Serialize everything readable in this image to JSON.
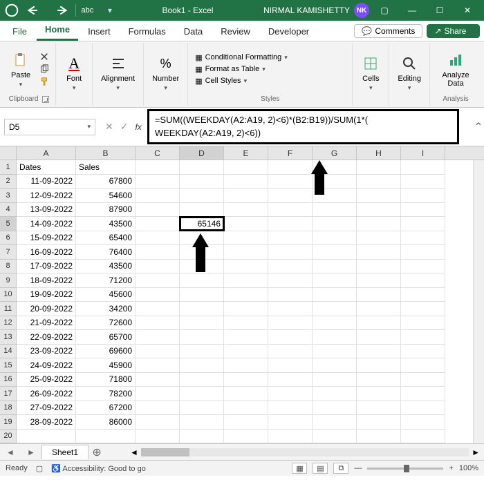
{
  "titlebar": {
    "doc": "Book1 - Excel",
    "user_name": "NIRMAL KAMISHETTY",
    "user_initials": "NK"
  },
  "tabs": {
    "file": "File",
    "home": "Home",
    "insert": "Insert",
    "formulas": "Formulas",
    "data": "Data",
    "review": "Review",
    "developer": "Developer",
    "comments": "Comments",
    "share": "Share"
  },
  "ribbon": {
    "clipboard": "Clipboard",
    "paste": "Paste",
    "font": "Font",
    "alignment": "Alignment",
    "number": "Number",
    "styles": "Styles",
    "cf": "Conditional Formatting",
    "fat": "Format as Table",
    "cs": "Cell Styles",
    "cells": "Cells",
    "editing": "Editing",
    "analyze": "Analyze Data",
    "analysis": "Analysis"
  },
  "editor": {
    "namebox": "D5",
    "formula_l1": "=SUM((WEEKDAY(A2:A19, 2)<6)*(B2:B19))/SUM(1*(",
    "formula_l2": "WEEKDAY(A2:A19, 2)<6))"
  },
  "columns": [
    "A",
    "B",
    "C",
    "D",
    "E",
    "F",
    "G",
    "H",
    "I"
  ],
  "headers": {
    "A": "Dates",
    "B": "Sales"
  },
  "rows": [
    {
      "n": 1,
      "A": "Dates",
      "B": "Sales"
    },
    {
      "n": 2,
      "A": "11-09-2022",
      "B": "67800"
    },
    {
      "n": 3,
      "A": "12-09-2022",
      "B": "54600"
    },
    {
      "n": 4,
      "A": "13-09-2022",
      "B": "87900"
    },
    {
      "n": 5,
      "A": "14-09-2022",
      "B": "43500",
      "D": "65146"
    },
    {
      "n": 6,
      "A": "15-09-2022",
      "B": "65400"
    },
    {
      "n": 7,
      "A": "16-09-2022",
      "B": "76400"
    },
    {
      "n": 8,
      "A": "17-09-2022",
      "B": "43500"
    },
    {
      "n": 9,
      "A": "18-09-2022",
      "B": "71200"
    },
    {
      "n": 10,
      "A": "19-09-2022",
      "B": "45600"
    },
    {
      "n": 11,
      "A": "20-09-2022",
      "B": "34200"
    },
    {
      "n": 12,
      "A": "21-09-2022",
      "B": "72600"
    },
    {
      "n": 13,
      "A": "22-09-2022",
      "B": "65700"
    },
    {
      "n": 14,
      "A": "23-09-2022",
      "B": "69600"
    },
    {
      "n": 15,
      "A": "24-09-2022",
      "B": "45900"
    },
    {
      "n": 16,
      "A": "25-09-2022",
      "B": "71800"
    },
    {
      "n": 17,
      "A": "26-09-2022",
      "B": "78200"
    },
    {
      "n": 18,
      "A": "27-09-2022",
      "B": "67200"
    },
    {
      "n": 19,
      "A": "28-09-2022",
      "B": "86000"
    },
    {
      "n": 20
    }
  ],
  "active_cell": {
    "row": 5,
    "col": "D",
    "value": "65146"
  },
  "sheet": {
    "name": "Sheet1"
  },
  "status": {
    "ready": "Ready",
    "acc": "Accessibility: Good to go",
    "zoom": "100%"
  }
}
